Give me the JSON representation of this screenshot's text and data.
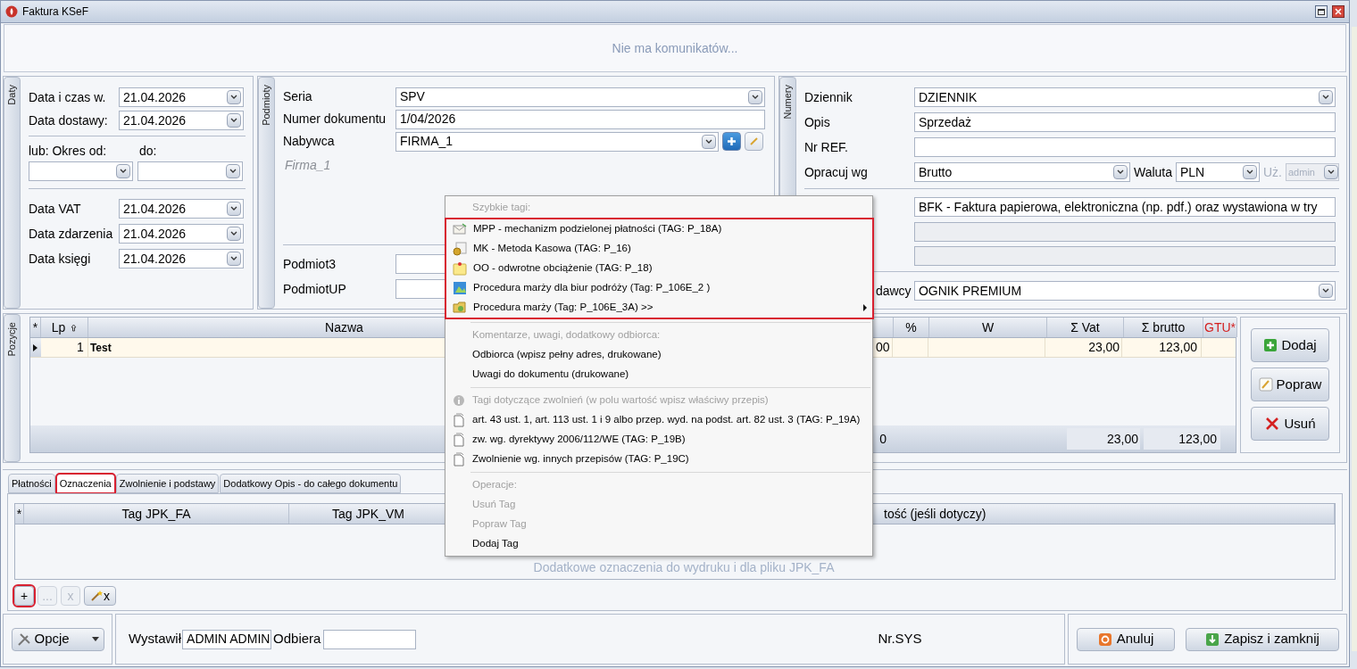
{
  "window": {
    "title": "Faktura KSeF"
  },
  "messages": {
    "text": "Nie ma komunikatów..."
  },
  "dates": {
    "tab": "Daty",
    "top_fields": [
      {
        "label": "Data i czas w.",
        "value": "21.04.2026"
      },
      {
        "label": "Data dostawy:",
        "value": "21.04.2026"
      }
    ],
    "period": {
      "from_label": "lub: Okres od:",
      "to_label": "do:"
    },
    "bottom_fields": [
      {
        "label": "Data VAT",
        "value": "21.04.2026"
      },
      {
        "label": "Data zdarzenia",
        "value": "21.04.2026"
      },
      {
        "label": "Data księgi",
        "value": "21.04.2026"
      }
    ]
  },
  "parties": {
    "tab": "Podmioty",
    "fields": [
      {
        "label": "Seria",
        "value": "SPV",
        "kind": "dropdown"
      },
      {
        "label": "Numer dokumentu",
        "value": "1/04/2026",
        "kind": "text"
      },
      {
        "label": "Nabywca",
        "value": "FIRMA_1",
        "kind": "dropdown_actions"
      }
    ],
    "buyer_name": "Firma_1",
    "extra_fields": [
      {
        "label": "Podmiot3"
      },
      {
        "label": "PodmiotUP"
      }
    ]
  },
  "numbers": {
    "tab": "Numery",
    "fields": [
      {
        "label": "Dziennik",
        "value": "DZIENNIK",
        "kind": "dropdown"
      },
      {
        "label": "Opis",
        "value": "Sprzedaż",
        "kind": "text"
      },
      {
        "label": "Nr REF.",
        "kind": "text"
      }
    ],
    "processing": {
      "label": "Opracuj wg",
      "value": "Brutto",
      "currency_label": "Waluta",
      "currency": "PLN",
      "user_label": "Uż.",
      "user": "admin",
      "user_disabled": true
    },
    "document_type": {
      "value": "BFK - Faktura papierowa, elektroniczna (np. pdf.) oraz wystawiona w try"
    },
    "extra_lines": [
      {
        "disabled": true
      },
      {
        "disabled": true
      }
    ],
    "supplier": {
      "label": "dawcy",
      "value": "OGNIK PREMIUM"
    }
  },
  "items": {
    "tab": "Pozycje",
    "columns": [
      {
        "label": "*",
        "kind": "marker"
      },
      {
        "label": "Lp",
        "kind": "sort"
      },
      {
        "label": "Nazwa",
        "kind": "plain"
      },
      {
        "kind": "covered"
      },
      {
        "label": "%",
        "kind": "plain"
      },
      {
        "label": "W",
        "kind": "plain"
      },
      {
        "label": "Σ Vat",
        "kind": "plain"
      },
      {
        "label": "Σ brutto",
        "kind": "plain"
      },
      {
        "label": "GTU*",
        "kind": "required"
      }
    ],
    "rows": [
      {
        "lp": "1",
        "name": "Test",
        "column_4": "00",
        "vat": "23,00",
        "gross": "123,00",
        "current": true
      }
    ],
    "totals": {
      "column_4": "0",
      "vat": "23,00",
      "gross": "123,00"
    },
    "buttons": [
      {
        "label": "Dodaj",
        "kind": "add"
      },
      {
        "label": "Popraw",
        "kind": "edit"
      },
      {
        "label": "Usuń",
        "kind": "delete"
      }
    ]
  },
  "tabs": [
    {
      "label": "Płatności",
      "selected": false,
      "highlighted": false
    },
    {
      "label": "Oznaczenia",
      "selected": true,
      "highlighted": true
    },
    {
      "label": "Zwolnienie i podstawy",
      "selected": false,
      "highlighted": false
    },
    {
      "label": "Dodatkowy Opis - do całego dokumentu",
      "selected": false,
      "highlighted": false
    }
  ],
  "tags": {
    "columns": [
      {
        "label": "*",
        "kind": "marker"
      },
      {
        "label": "Tag JPK_FA",
        "kind": "plain"
      },
      {
        "label": "Tag JPK_VM",
        "kind": "plain"
      },
      {
        "label": "tość (jeśli dotyczy)",
        "kind": "covered"
      }
    ],
    "empty_text": "Dodatkowe oznaczenia do wydruku i dla pliku JPK_FA",
    "toolbar": [
      {
        "label": "+",
        "kind": "text",
        "disabled": false,
        "highlighted": true
      },
      {
        "label": "...",
        "kind": "text",
        "disabled": true,
        "highlighted": false
      },
      {
        "label": "x",
        "kind": "text",
        "disabled": true,
        "highlighted": false
      },
      {
        "label": "x",
        "kind": "wand",
        "disabled": false,
        "highlighted": false
      }
    ]
  },
  "footer": {
    "options": "Opcje",
    "issued": {
      "label": "Wystawił",
      "value": "ADMIN ADMIN"
    },
    "receiver": {
      "label": "Odbiera"
    },
    "sys": "Nr.SYS",
    "buttons": [
      {
        "label": "Anuluj",
        "kind": "cancel"
      },
      {
        "label": "Zapisz i zamknij",
        "kind": "save"
      }
    ]
  },
  "menu": {
    "sections": [
      {
        "title": "Szybkie tagi:",
        "highlighted": true,
        "items": [
          {
            "label": "MPP - mechanizm podzielonej płatności (TAG: P_18A)",
            "disabled": false,
            "submenu": false
          },
          {
            "label": "MK - Metoda Kasowa (TAG: P_16)",
            "disabled": false,
            "submenu": false
          },
          {
            "label": "OO - odwrotne obciążenie (TAG: P_18)",
            "disabled": false,
            "submenu": false
          },
          {
            "label": "Procedura marży dla biur podróży (Tag: P_106E_2 )",
            "disabled": false,
            "submenu": false
          },
          {
            "label": "Procedura marży (Tag: P_106E_3A) >>",
            "disabled": false,
            "submenu": true
          }
        ]
      },
      {
        "title": "Komentarze, uwagi, dodatkowy odbiorca:",
        "highlighted": false,
        "items": [
          {
            "label": "Odbiorca (wpisz pełny adres, drukowane)",
            "disabled": false,
            "submenu": false
          },
          {
            "label": "Uwagi do dokumentu (drukowane)",
            "disabled": false,
            "submenu": false
          }
        ]
      },
      {
        "title": "Tagi dotyczące zwolnień (w polu wartość wpisz właściwy przepis)",
        "highlighted": false,
        "items": [
          {
            "label": "art. 43 ust. 1, art. 113 ust. 1 i 9 albo przep. wyd. na podst. art. 82 ust. 3 (TAG: P_19A)",
            "disabled": false,
            "submenu": false
          },
          {
            "label": "zw. wg. dyrektywy 2006/112/WE (TAG: P_19B)",
            "disabled": false,
            "submenu": false
          },
          {
            "label": "Zwolnienie wg. innych przepisów (TAG: P_19C)",
            "disabled": false,
            "submenu": false
          }
        ]
      },
      {
        "title": "Operacje:",
        "highlighted": false,
        "items": [
          {
            "label": "Usuń Tag",
            "disabled": true,
            "submenu": false
          },
          {
            "label": "Popraw Tag",
            "disabled": true,
            "submenu": false
          },
          {
            "label": "Dodaj Tag",
            "disabled": false,
            "submenu": false
          }
        ]
      }
    ]
  }
}
